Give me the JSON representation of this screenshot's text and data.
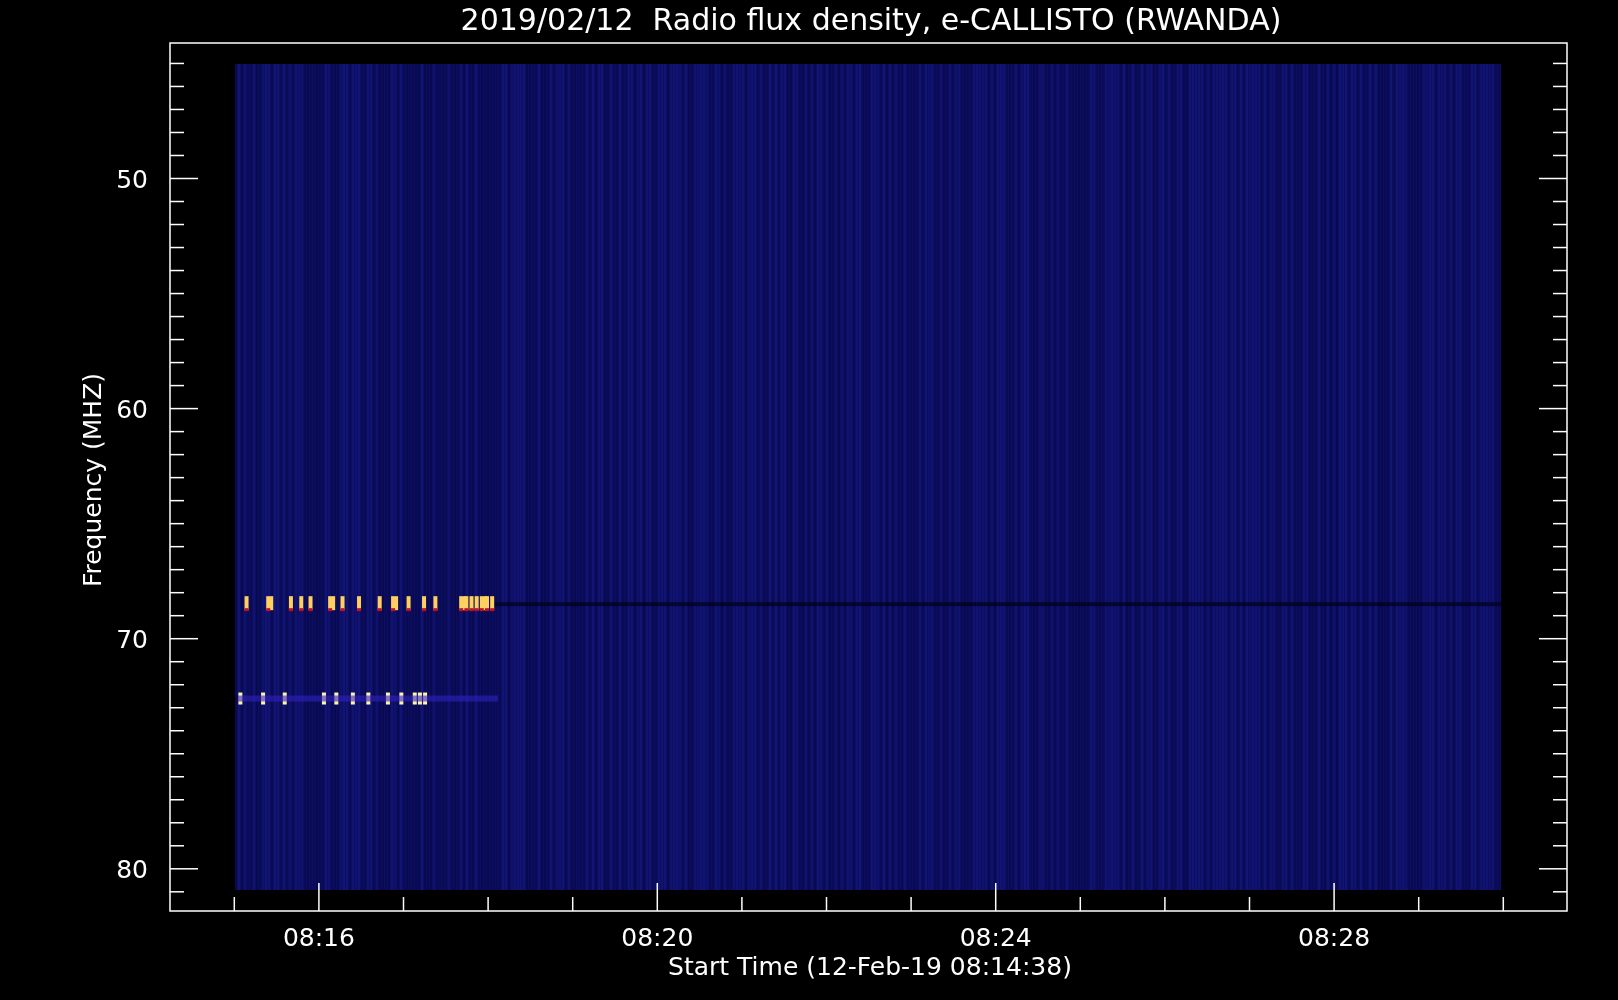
{
  "title": "2019/02/12  Radio flux density, e-CALLISTO (RWANDA)",
  "xlabel": "Start Time (12-Feb-19 08:14:38)",
  "ylabel": "Frequency (MHZ)",
  "xticks": [
    "08:16",
    "08:20",
    "08:24",
    "08:28"
  ],
  "yticks": [
    "50",
    "60",
    "70",
    "80"
  ]
}
